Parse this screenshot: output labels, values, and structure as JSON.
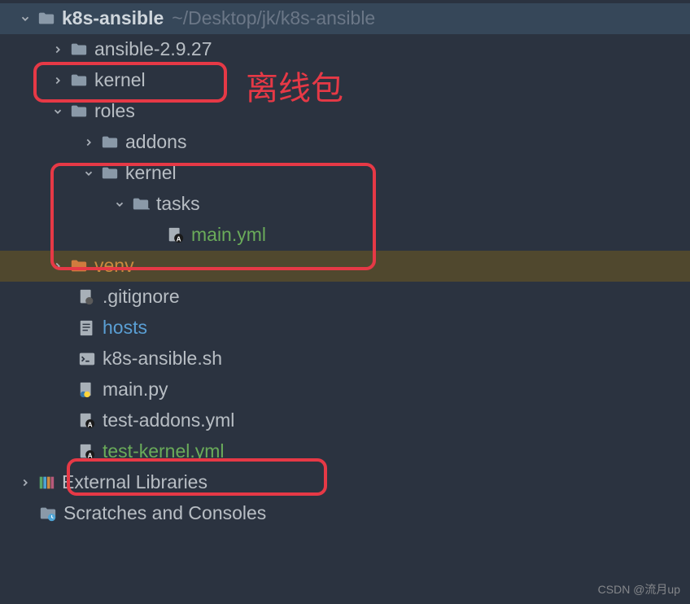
{
  "project": {
    "name": "k8s-ansible",
    "path": "~/Desktop/jk/k8s-ansible"
  },
  "tree": {
    "ansible": "ansible-2.9.27",
    "kernel": "kernel",
    "roles": "roles",
    "addons": "addons",
    "roles_kernel": "kernel",
    "tasks": "tasks",
    "main_yml": "main.yml",
    "venv": "venv",
    "gitignore": ".gitignore",
    "hosts": "hosts",
    "k8s_sh": "k8s-ansible.sh",
    "main_py": "main.py",
    "test_addons": "test-addons.yml",
    "test_kernel": "test-kernel.yml"
  },
  "external": "External Libraries",
  "scratches": "Scratches and Consoles",
  "annotation": "离线包",
  "watermark": "CSDN @流月up"
}
